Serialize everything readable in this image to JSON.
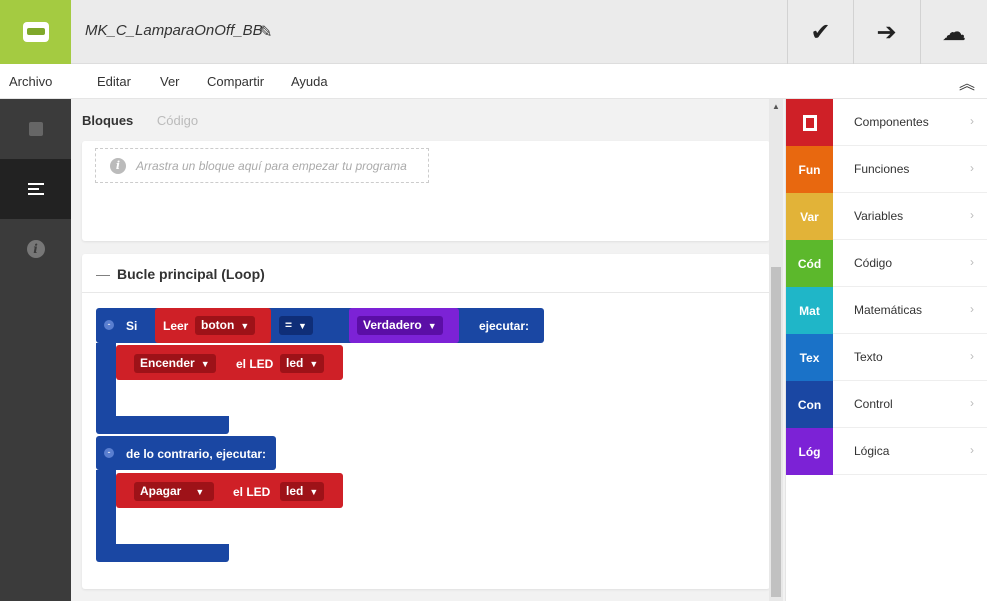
{
  "header": {
    "project_title": "MK_C_LamparaOnOff_BB",
    "edit_icon": "pencil-icon",
    "actions": [
      {
        "name": "verify",
        "glyph": "✔",
        "icon": "check-icon"
      },
      {
        "name": "upload",
        "glyph": "➔",
        "icon": "arrow-right-icon"
      },
      {
        "name": "cloud",
        "glyph": "☁",
        "icon": "cloud-icon"
      }
    ]
  },
  "menu": {
    "items": [
      "Archivo",
      "Editar",
      "Ver",
      "Compartir",
      "Ayuda"
    ],
    "collapse_glyph": "≫"
  },
  "rail": {
    "items": [
      "hardware-icon",
      "blocks-icon",
      "info-icon"
    ],
    "active": 1
  },
  "tabs": {
    "bloques": "Bloques",
    "codigo": "Código"
  },
  "setup": {
    "dropzone_text": "Arrastra un bloque aquí para empezar tu programa"
  },
  "loop": {
    "title": "Bucle principal (Loop)",
    "if_keyword": "Si",
    "read_label": "Leer",
    "read_var": "boton",
    "operator": "=",
    "value": "Verdadero",
    "then_label": "ejecutar:",
    "then_action": "Encender",
    "led_label": "el LED",
    "led_var": "led",
    "else_label": "de lo contrario, ejecutar:",
    "else_action": "Apagar",
    "else_led_label": "el LED",
    "else_led_var": "led"
  },
  "palette": {
    "items": [
      {
        "abbr": "",
        "label": "Componentes",
        "color": "#cf2027"
      },
      {
        "abbr": "Fun",
        "label": "Funciones",
        "color": "#e8680f"
      },
      {
        "abbr": "Var",
        "label": "Variables",
        "color": "#e2b338"
      },
      {
        "abbr": "Cód",
        "label": "Código",
        "color": "#5cb82c"
      },
      {
        "abbr": "Mat",
        "label": "Matemáticas",
        "color": "#1fb6c8"
      },
      {
        "abbr": "Tex",
        "label": "Texto",
        "color": "#1a72c8"
      },
      {
        "abbr": "Con",
        "label": "Control",
        "color": "#1a47a3"
      },
      {
        "abbr": "Lóg",
        "label": "Lógica",
        "color": "#7c22d6"
      }
    ]
  }
}
